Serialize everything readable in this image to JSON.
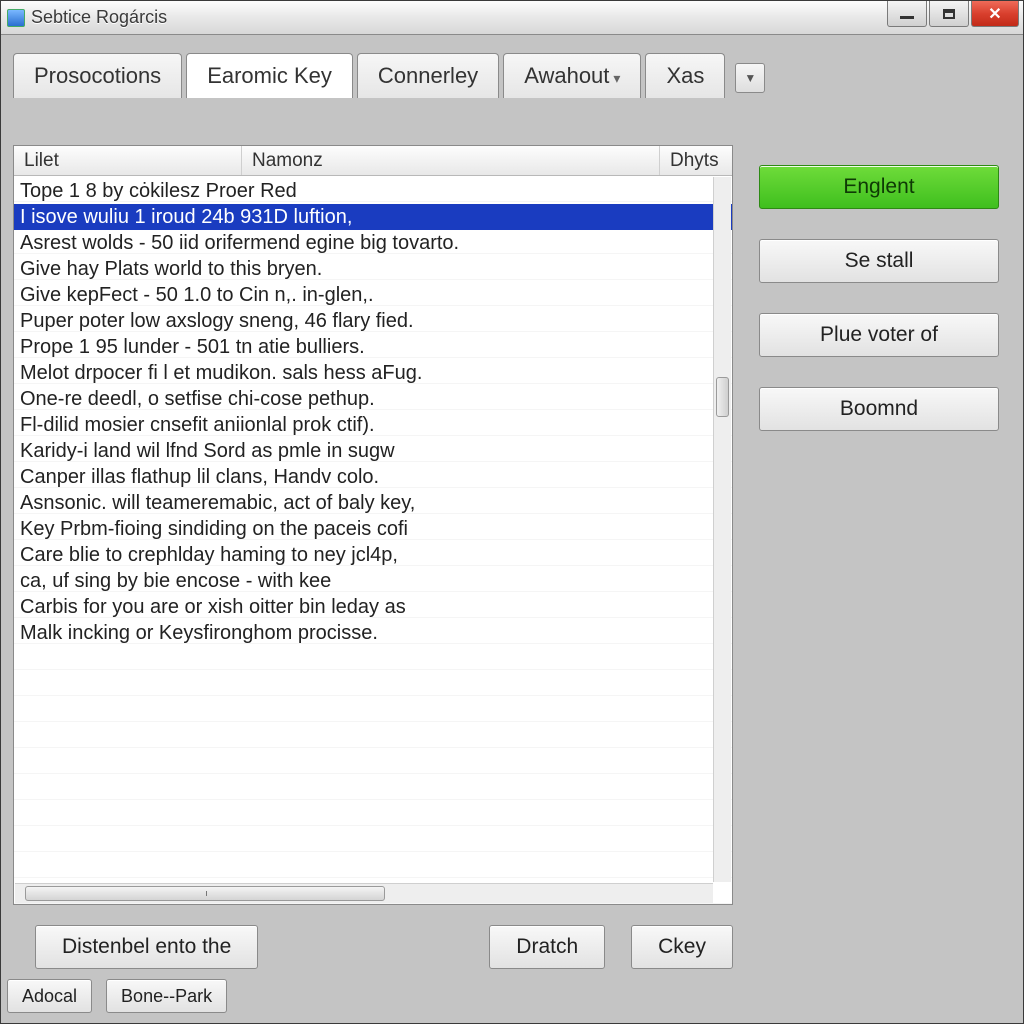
{
  "window": {
    "title": "Sebtice Rogárcis"
  },
  "tabs": {
    "items": [
      {
        "label": "Prosocotions"
      },
      {
        "label": "Earomic Key"
      },
      {
        "label": "Connerley"
      },
      {
        "label": "Awahout"
      },
      {
        "label": "Xas"
      }
    ],
    "active_index": 1
  },
  "listview": {
    "columns": {
      "c1": "Lilet",
      "c2": "Namonz",
      "c3": "Dhyts"
    },
    "rows": [
      "Tope 1 8 by cȯkilesz Proer Red",
      "I isove wuliu 1 iroud 24b 931D luftion,",
      "Asrest wolds - 50 iid orifermend egine big tovarto.",
      "Give hay Plats world to this bryen.",
      "Give kepFect - 50 1.0 to Cin n,. in-glen,.",
      "Puper poter low axslogy sneng, 46 flary fied.",
      "Prope 1 95 lunder - 501 tn atie bulliers.",
      "Melot drpocer fi l et mudikon. sals hess aFug.",
      "One-re deedl, o setfise chi-cose pethup.",
      "Fl-dilid mosier cnsefit aniionlal prok ctif).",
      "Karidy-i land wil lfnd Sord as pmle in sugw",
      "Canper illas flathup lil clans, Handv colo.",
      "Asnsonic. will teameremabic, act of baly key,",
      "Key Prbm-fioing sindiding on the paceis cofi",
      "Care blie to crephlday haming to ney jcl4p,",
      "ca, uf sing by bie encose - with kee",
      "Carbis for you are or xish oitter bin leday as",
      "Malk incking or Keysfironghom procisse."
    ],
    "selected_index": 1
  },
  "side_buttons": {
    "primary": "Englent",
    "b2": "Se stall",
    "b3": "Plue voter of",
    "b4": "Boomnd"
  },
  "bottom_buttons": {
    "b1": "Distenbel ento the",
    "b2": "Dratch",
    "b3": "Ckey"
  },
  "footer_buttons": {
    "b1": "Adocal",
    "b2": "Bone--Park"
  }
}
